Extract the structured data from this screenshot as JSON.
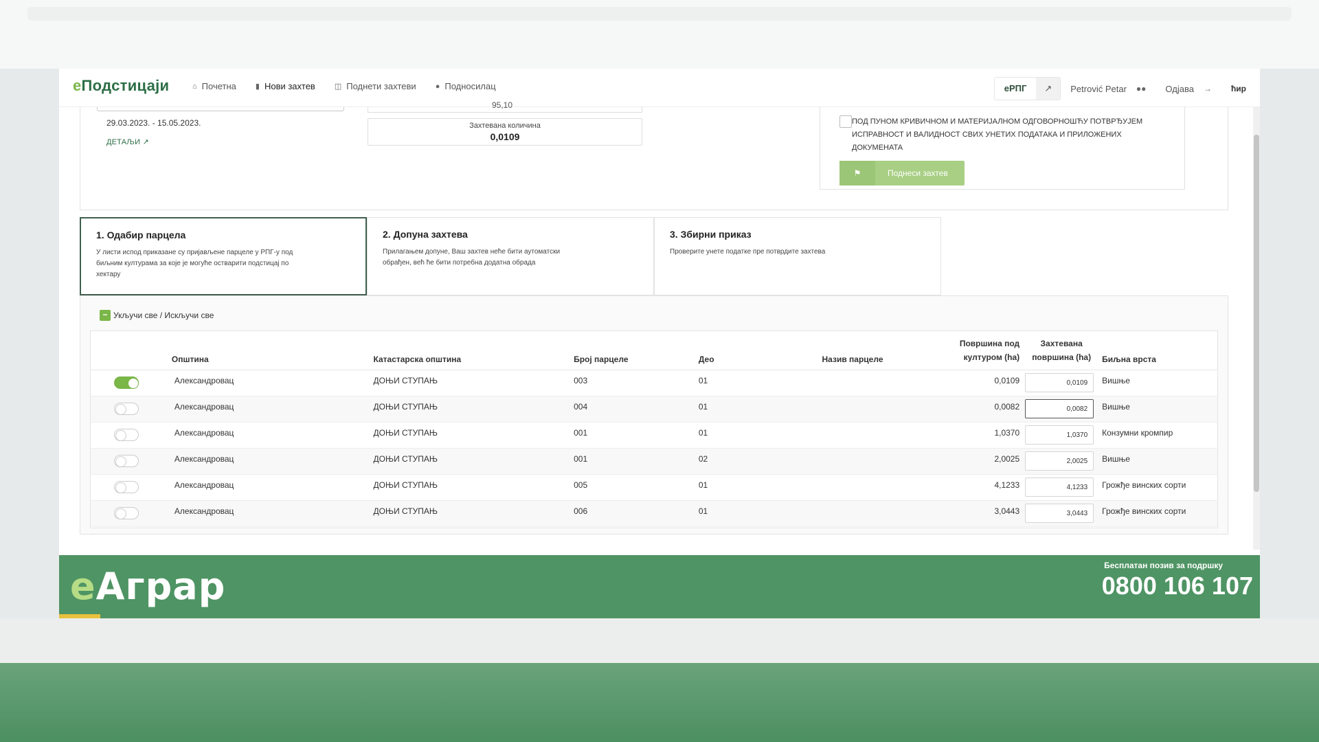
{
  "nav": {
    "brand_e": "е",
    "brand_rest": "Подстицаји",
    "items": [
      {
        "label": "Почетна",
        "icon": "home-icon"
      },
      {
        "label": "Нови захтев",
        "icon": "file-icon"
      },
      {
        "label": "Поднети захтеви",
        "icon": "folder-icon"
      },
      {
        "label": "Подносилац",
        "icon": "user-icon"
      }
    ],
    "erpg": "еРПГ",
    "user": "Petrović Petar",
    "logout": "Одјава",
    "lang": "ћир"
  },
  "info": {
    "date_range": "29.03.2023. - 15.05.2023.",
    "details": "ДЕТАЉИ",
    "qty_remnant": "95,10",
    "qty_label": "Захтевана количина",
    "qty_value": "0,0109",
    "declaration": "ПОД ПУНОМ КРИВИЧНОМ И МАТЕРИЈАЛНОМ ОДГОВОРНОШЋУ ПОТВРЂУЈЕМ ИСПРАВНОСТ И ВАЛИДНОСТ СВИХ УНЕТИХ ПОДАТАКА И ПРИЛОЖЕНИХ ДОКУМЕНАТА",
    "submit": "Поднеси захтев"
  },
  "steps": [
    {
      "title": "1. Одабир парцела",
      "desc": "У листи испод приказане су пријављене парцеле у РПГ-у под биљним културама за које је могуће остварити подстицај по хектару"
    },
    {
      "title": "2. Допуна захтева",
      "desc": "Прилагањем допуне, Ваш захтев неће бити аутоматски обрађен, већ ће бити потребна додатна обрада"
    },
    {
      "title": "3. Збирни приказ",
      "desc": "Проверите унете податке пре потврдите захтева"
    }
  ],
  "table": {
    "toggle_all": "Укључи све / Искључи све",
    "headers": {
      "municipality": "Општина",
      "cadastral": "Катастарска општина",
      "parcel_no": "Број парцеле",
      "part": "Део",
      "parcel_name": "Назив парцеле",
      "area_crop_1": "Површина под",
      "area_crop_2": "културом (ha)",
      "requested_1": "Захтевана",
      "requested_2": "површина (ha)",
      "plant": "Биљна врста"
    },
    "rows": [
      {
        "on": true,
        "municipality": "Александровац",
        "cadastral": "ДОЊИ СТУПАЊ",
        "parcel_no": "003",
        "part": "01",
        "name": "",
        "area": "0,0109",
        "requested": "0,0109",
        "plant": "Вишње"
      },
      {
        "on": false,
        "municipality": "Александровац",
        "cadastral": "ДОЊИ СТУПАЊ",
        "parcel_no": "004",
        "part": "01",
        "name": "",
        "area": "0,0082",
        "requested": "0,0082",
        "plant": "Вишње"
      },
      {
        "on": false,
        "municipality": "Александровац",
        "cadastral": "ДОЊИ СТУПАЊ",
        "parcel_no": "001",
        "part": "01",
        "name": "",
        "area": "1,0370",
        "requested": "1,0370",
        "plant": "Конзумни кромпир"
      },
      {
        "on": false,
        "municipality": "Александровац",
        "cadastral": "ДОЊИ СТУПАЊ",
        "parcel_no": "001",
        "part": "02",
        "name": "",
        "area": "2,0025",
        "requested": "2,0025",
        "plant": "Вишње"
      },
      {
        "on": false,
        "municipality": "Александровац",
        "cadastral": "ДОЊИ СТУПАЊ",
        "parcel_no": "005",
        "part": "01",
        "name": "",
        "area": "4,1233",
        "requested": "4,1233",
        "plant": "Грожђе винских сорти"
      },
      {
        "on": false,
        "municipality": "Александровац",
        "cadastral": "ДОЊИ СТУПАЊ",
        "parcel_no": "006",
        "part": "01",
        "name": "",
        "area": "3,0443",
        "requested": "3,0443",
        "plant": "Грожђе винских сорти"
      }
    ]
  },
  "footer": {
    "logo_e": "е",
    "logo_rest": "Аграр",
    "support_label": "Бесплатан позив за подршку",
    "phone": "0800 106 107"
  },
  "colors": {
    "brand_green": "#2d6e46",
    "accent_green": "#7ab648",
    "footer_green": "#4f9464",
    "submit_disabled": "#a8cf84"
  }
}
